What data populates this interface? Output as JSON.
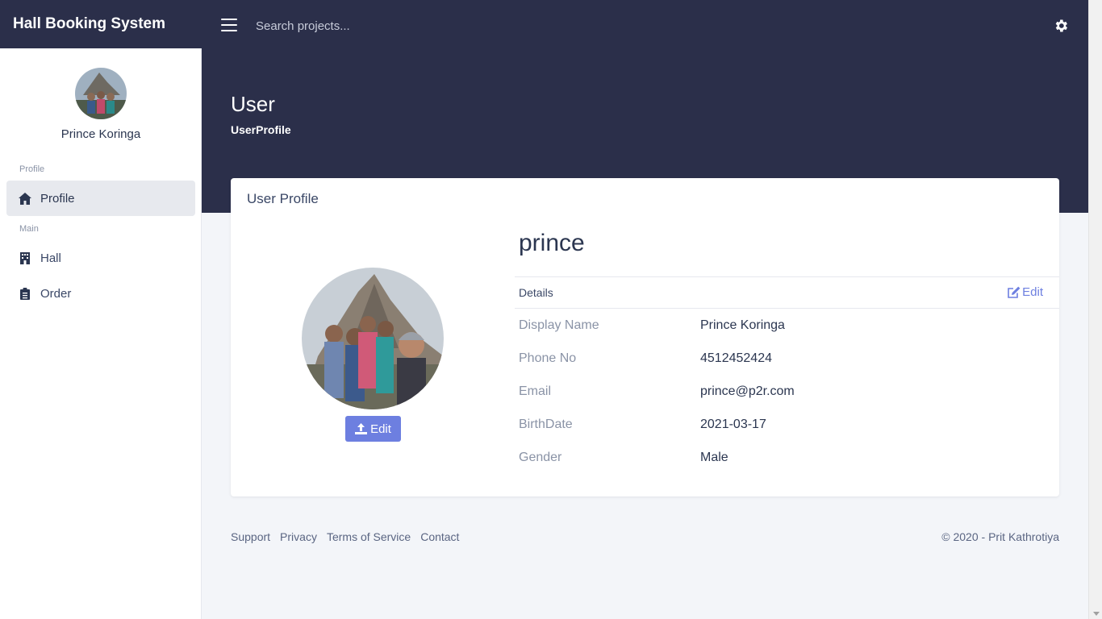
{
  "app": {
    "brand": "Hall Booking System"
  },
  "topbar": {
    "search_placeholder": "Search projects..."
  },
  "sidebar": {
    "user_name": "Prince Koringa",
    "sections": [
      {
        "heading": "Profile",
        "items": [
          {
            "label": "Profile",
            "icon": "home-icon",
            "active": true
          }
        ]
      },
      {
        "heading": "Main",
        "items": [
          {
            "label": "Hall",
            "icon": "building-icon"
          },
          {
            "label": "Order",
            "icon": "clipboard-icon"
          }
        ]
      }
    ]
  },
  "header": {
    "title": "User",
    "subtitle": "UserProfile"
  },
  "card": {
    "title": "User Profile",
    "edit_photo_label": "Edit",
    "username": "prince",
    "details_label": "Details",
    "details_edit_label": "Edit",
    "fields": [
      {
        "label": "Display Name",
        "value": "Prince Koringa"
      },
      {
        "label": "Phone No",
        "value": "4512452424"
      },
      {
        "label": "Email",
        "value": "prince@p2r.com"
      },
      {
        "label": "BirthDate",
        "value": "2021-03-17"
      },
      {
        "label": "Gender",
        "value": "Male"
      }
    ]
  },
  "footer": {
    "links": [
      "Support",
      "Privacy",
      "Terms of Service",
      "Contact"
    ],
    "copyright": "© 2020 - Prit Kathrotiya"
  },
  "colors": {
    "dark": "#2b2f4a",
    "accent": "#6d7fe0",
    "background": "#f3f5f9"
  }
}
